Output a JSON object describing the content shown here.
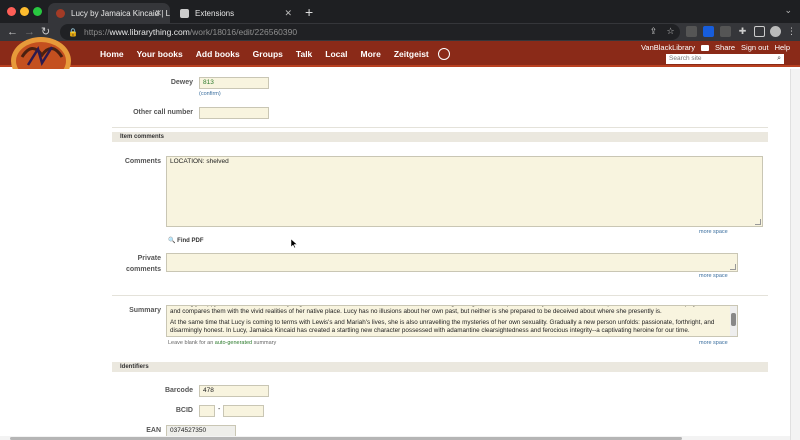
{
  "browser": {
    "tabs": [
      {
        "title": "Lucy by Jamaica Kincaid | Libr",
        "active": true
      },
      {
        "title": "Extensions",
        "active": false
      }
    ],
    "url": {
      "scheme": "https://",
      "host": "www.librarything.com",
      "path": "/work/18016/edit/226560390"
    }
  },
  "site": {
    "nav": [
      "Home",
      "Your books",
      "Add books",
      "Groups",
      "Talk",
      "Local",
      "More",
      "Zeitgeist"
    ],
    "user": "VanBlackLibrary",
    "share": "Share",
    "signout": "Sign out",
    "help": "Help",
    "search_placeholder": "Search site"
  },
  "form": {
    "dewey": {
      "label": "Dewey",
      "value": "813",
      "confirm": "(confirm)"
    },
    "other_call": {
      "label": "Other call number",
      "value": ""
    },
    "item_comments_header": "Item comments",
    "comments": {
      "label": "Comments",
      "value": "LOCATION: shelved",
      "more": "more space"
    },
    "find_pdf": "Find PDF",
    "private": {
      "label1": "Private",
      "label2": "comments",
      "value": "",
      "more": "more space"
    },
    "summary": {
      "label": "Summary",
      "para1": "seemingly happy. Yet, almost at once, Lucy begins to notice cracks in their beautiful facade. With mingled anger and compassion, Lucy scrutinizes the assumptions and values of her employers' world and compares them with the vivid realities of her native place. Lucy has no illusions about her own past, but neither is she prepared to be deceived about where she presently is.",
      "para2": "At the same time that Lucy is coming to terms with Lewis's and Mariah's lives, she is also unravelling the mysteries of her own sexuality. Gradually a new person unfolds: passionate, forthright, and disarmingly honest. In Lucy, Jamaica Kincaid has created a startling new character possessed with adamantine clearsightedness and ferocious integrity--a captivating heroine for our time.",
      "hint_pre": "Leave blank for an",
      "hint_link": "auto-generated",
      "hint_post": "summary",
      "more": "more space"
    },
    "identifiers_header": "Identifiers",
    "barcode": {
      "label": "Barcode",
      "value": "478"
    },
    "bcid": {
      "label": "BCID",
      "value1": "",
      "dash": "-",
      "value2": ""
    },
    "ean": {
      "label": "EAN",
      "value": "0374527350"
    }
  },
  "colors": {
    "header_bg": "#8a2a18",
    "field_bg": "#f8f4df",
    "section_bg": "#ebe8df",
    "link": "#3a6e9e",
    "green": "#2c7b2c"
  }
}
